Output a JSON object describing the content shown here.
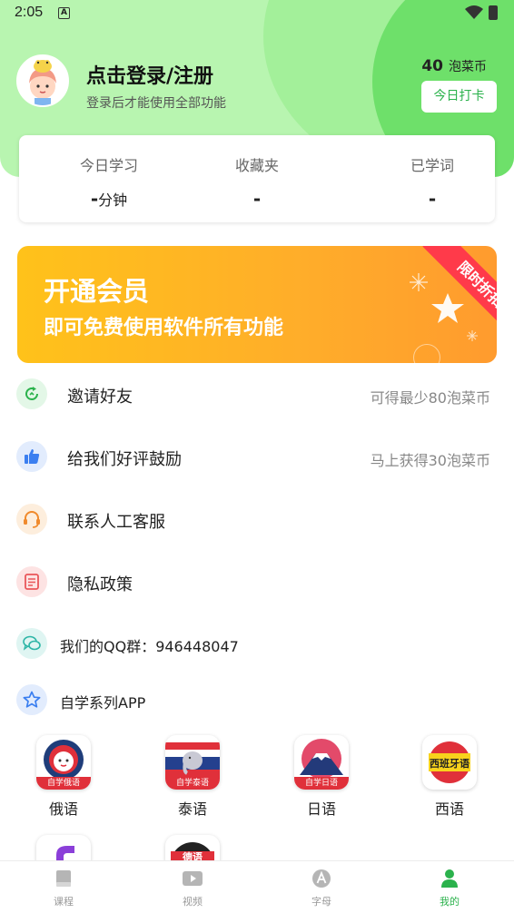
{
  "status_bar": {
    "time": "2:05",
    "notification_icon": "A"
  },
  "profile": {
    "title": "点击登录/注册",
    "subtitle": "登录后才能使用全部功能",
    "coins_value": "40",
    "coins_unit": "泡菜币",
    "checkin_label": "今日打卡"
  },
  "stats": [
    {
      "label": "今日学习",
      "value": "-",
      "unit": "分钟"
    },
    {
      "label": "收藏夹",
      "value": "-",
      "unit": ""
    },
    {
      "label": "已学词",
      "value": "-",
      "unit": ""
    }
  ],
  "vip_banner": {
    "title": "开通会员",
    "subtitle": "即可免费使用软件所有功能",
    "ribbon": "限时折扣"
  },
  "menu": [
    {
      "label": "邀请好友",
      "extra": "可得最少80泡菜币",
      "icon": "refresh-icon",
      "color": "#2bb24c"
    },
    {
      "label": "给我们好评鼓励",
      "extra": "马上获得30泡菜币",
      "icon": "thumbs-up-icon",
      "color": "#3b7ff0"
    },
    {
      "label": "联系人工客服",
      "extra": "",
      "icon": "headset-icon",
      "color": "#f08a2c"
    },
    {
      "label": "隐私政策",
      "extra": "",
      "icon": "document-icon",
      "color": "#e9565a"
    },
    {
      "label": "我们的QQ群：946448047",
      "extra": "",
      "icon": "chat-icon",
      "color": "#2cb5a6"
    },
    {
      "label": "自学系列APP",
      "extra": "",
      "icon": "star-icon",
      "color": "#3b7ff0"
    }
  ],
  "apps": [
    {
      "name": "俄语",
      "tag": "自学俄语"
    },
    {
      "name": "泰语",
      "tag": "自学泰语"
    },
    {
      "name": "日语",
      "tag": "自学日语"
    },
    {
      "name": "西语",
      "tag": "西班牙语"
    },
    {
      "name": "",
      "tag": ""
    },
    {
      "name": "",
      "tag": "德语"
    }
  ],
  "tabs": [
    {
      "label": "课程",
      "icon": "book-icon",
      "active": false
    },
    {
      "label": "视频",
      "icon": "play-icon",
      "active": false
    },
    {
      "label": "字母",
      "icon": "letter-a-icon",
      "active": false
    },
    {
      "label": "我的",
      "icon": "person-icon",
      "active": true
    }
  ],
  "colors": {
    "accent": "#2bb24c",
    "header_bg": "#b8f5b0",
    "banner": "#ffb01f",
    "ribbon": "#ff3a4a"
  }
}
